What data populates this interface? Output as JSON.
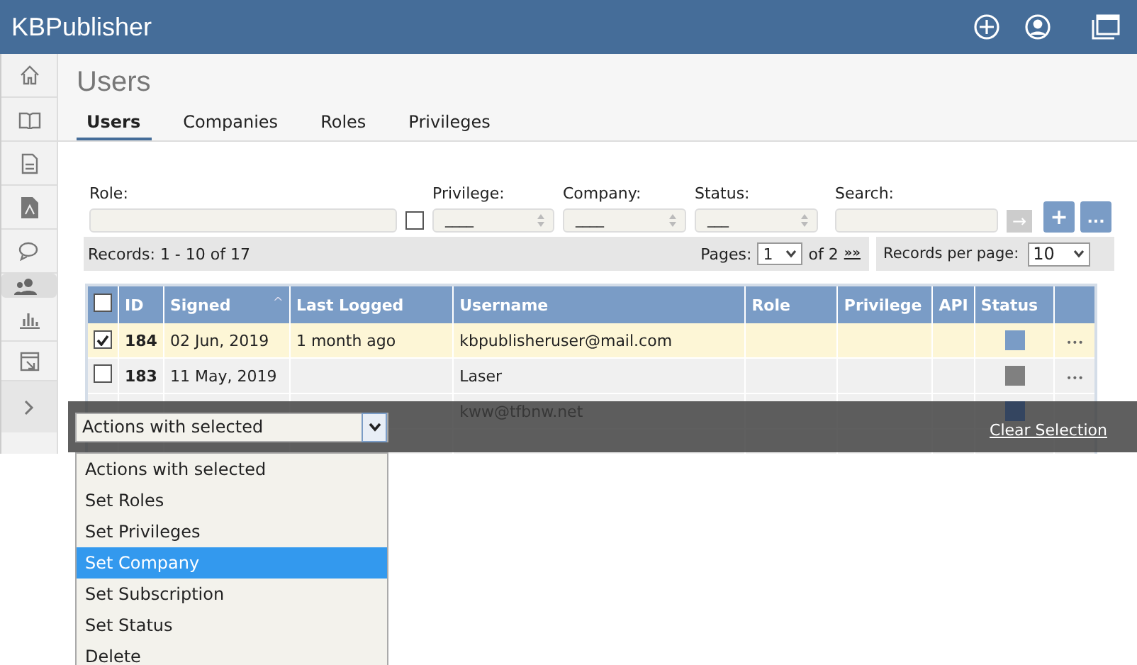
{
  "app": {
    "title": "KBPublisher"
  },
  "sidebar": {
    "items": [
      {
        "kind": "home",
        "selected": false
      },
      {
        "kind": "book",
        "selected": false
      },
      {
        "kind": "document",
        "selected": false
      },
      {
        "kind": "file",
        "selected": false
      },
      {
        "kind": "chat",
        "selected": false
      },
      {
        "kind": "users",
        "selected": true
      },
      {
        "kind": "chart",
        "selected": false
      },
      {
        "kind": "export",
        "selected": false
      }
    ]
  },
  "page": {
    "title": "Users"
  },
  "tabs": [
    {
      "label": "Users",
      "selected": true
    },
    {
      "label": "Companies",
      "selected": false
    },
    {
      "label": "Roles",
      "selected": false
    },
    {
      "label": "Privileges",
      "selected": false
    }
  ],
  "filters": {
    "role": {
      "label": "Role:",
      "checked": false
    },
    "privilege": {
      "label": "Privilege:",
      "value": "____"
    },
    "company": {
      "label": "Company:",
      "value": "____"
    },
    "status": {
      "label": "Status:",
      "value": "___"
    },
    "search": {
      "label": "Search:"
    },
    "go": "→",
    "add": "+",
    "more": "..."
  },
  "pager": {
    "records": "Records: 1 - 10 of 17",
    "pages_label": "Pages:",
    "page": "1",
    "of": "of 2",
    "next": "»»",
    "per_page_label": "Records per page:",
    "per_page": "10"
  },
  "table": {
    "select_all": {
      "checked": false
    },
    "columns": [
      "ID",
      "Signed",
      "Last Logged",
      "Username",
      "Role",
      "Privilege",
      "API",
      "Status"
    ],
    "sort_mark": "^",
    "rows": [
      {
        "selected": true,
        "checked": true,
        "id": "184",
        "signed": "02 Jun, 2019",
        "last_logged": "1 month ago",
        "username": "kbpublisheruser@mail.com",
        "color": "#7a9cc6",
        "menu": "•••"
      },
      {
        "selected": false,
        "checked": false,
        "id": "183",
        "signed": "11 May, 2019",
        "username": "Laser",
        "color": "#808080",
        "menu": "•••"
      },
      {
        "selected": false,
        "username": "kww@tfbnw.net",
        "color": "#344560"
      }
    ]
  },
  "action_bar": {
    "select_value": "Actions with selected",
    "expanded": true,
    "clear": "Clear Selection",
    "options": [
      {
        "label": "Actions with selected",
        "selected": false
      },
      {
        "label": "Set Roles",
        "selected": false
      },
      {
        "label": "Set Privileges",
        "selected": false
      },
      {
        "label": "Set Company",
        "selected": true
      },
      {
        "label": "Set Subscription",
        "selected": false
      },
      {
        "label": "Set Status",
        "selected": false
      },
      {
        "label": "Delete",
        "selected": false
      }
    ]
  }
}
